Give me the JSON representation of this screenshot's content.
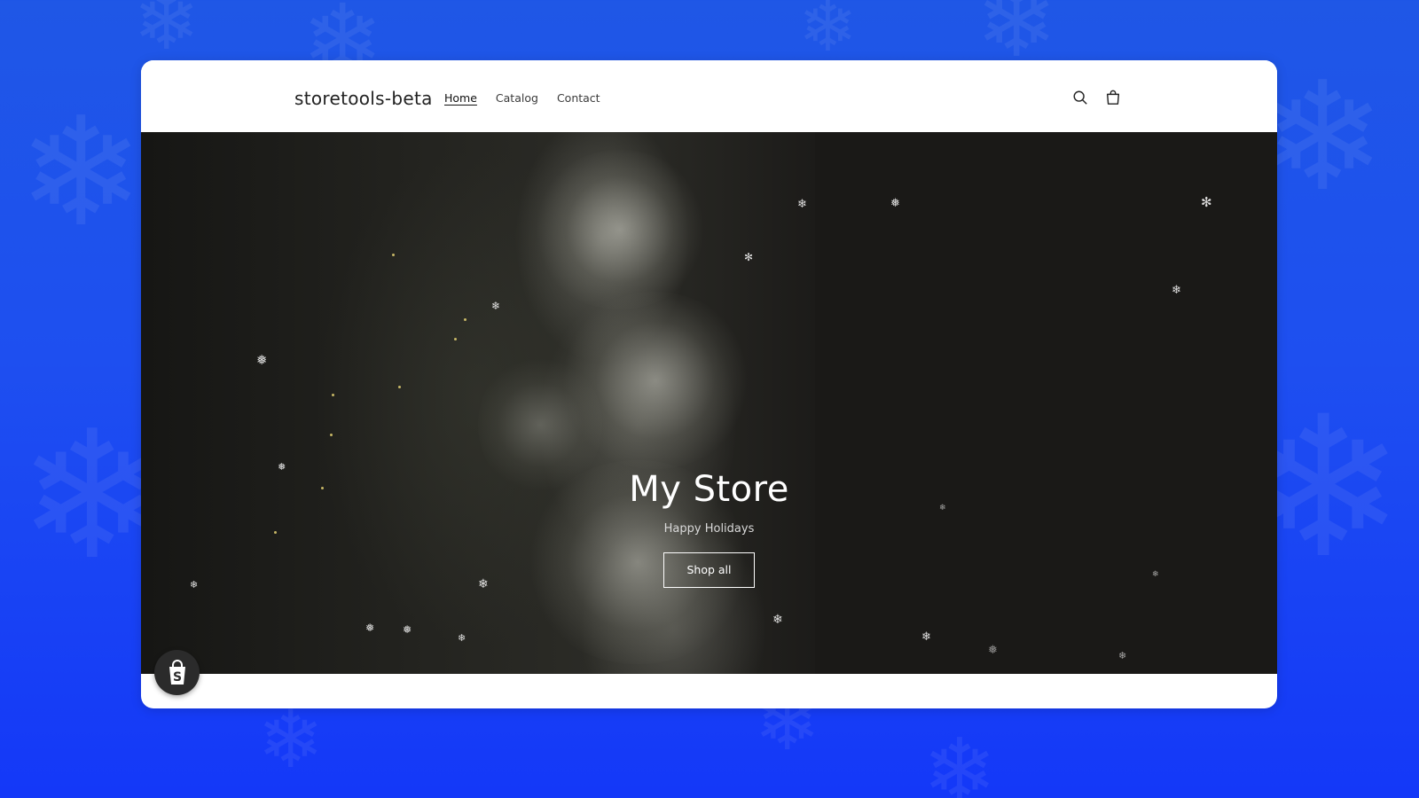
{
  "store": {
    "name": "storetools-beta"
  },
  "nav": {
    "items": [
      {
        "label": "Home",
        "active": true
      },
      {
        "label": "Catalog",
        "active": false
      },
      {
        "label": "Contact",
        "active": false
      }
    ]
  },
  "header_icons": [
    "search-icon",
    "cart-icon"
  ],
  "hero": {
    "title": "My Store",
    "subtitle": "Happy Holidays",
    "cta_label": "Shop all"
  },
  "badge": {
    "icon": "shopify-bag-icon"
  },
  "colors": {
    "background_top": "#1f57e6",
    "background_bottom": "#1438f8",
    "card": "#ffffff",
    "hero": "#1a1917",
    "text_dark": "#222222"
  }
}
